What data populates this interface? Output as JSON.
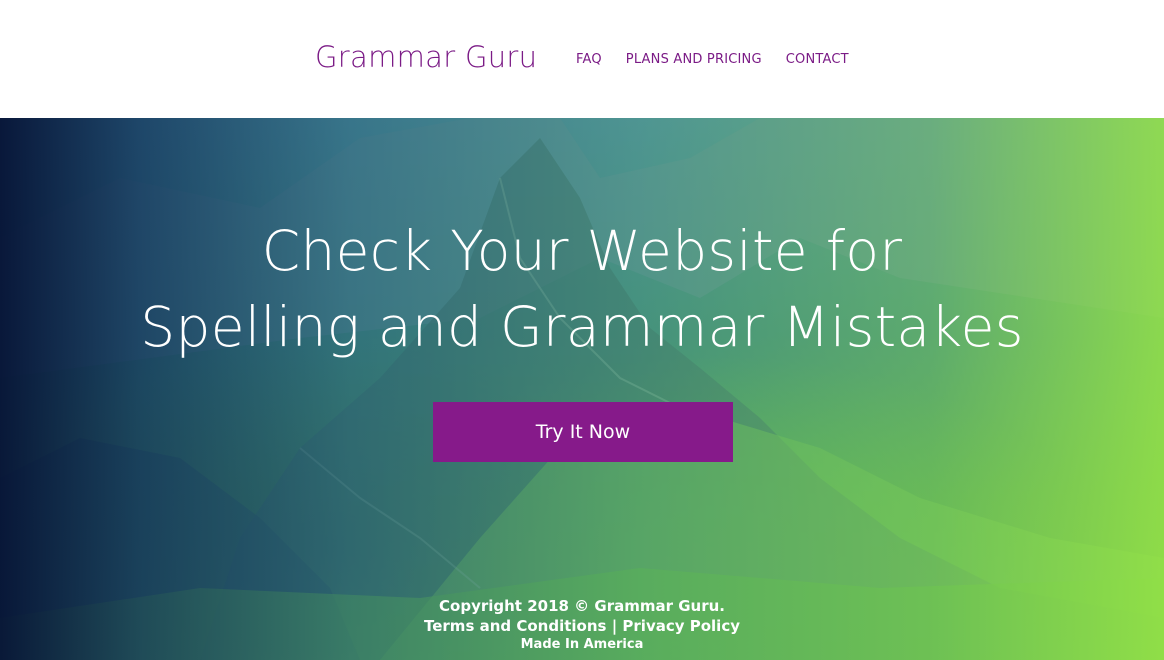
{
  "header": {
    "brand": "Grammar Guru",
    "nav": {
      "faq": "FAQ",
      "plans": "PLANS AND PRICING",
      "contact": "CONTACT"
    }
  },
  "hero": {
    "headline_line1": "Check Your Website for",
    "headline_line2": "Spelling and Grammar Mistakes",
    "cta_label": "Try It Now"
  },
  "footer": {
    "copyright": "Copyright 2018 © Grammar Guru.",
    "terms_label": "Terms and Conditions",
    "separator": "|",
    "privacy_label": "Privacy Policy",
    "made_in": "Made In America"
  },
  "colors": {
    "brand_purple": "#7b1b86",
    "button_purple": "#861a8a",
    "gradient_left": "#06143a",
    "gradient_right": "#96e646"
  }
}
